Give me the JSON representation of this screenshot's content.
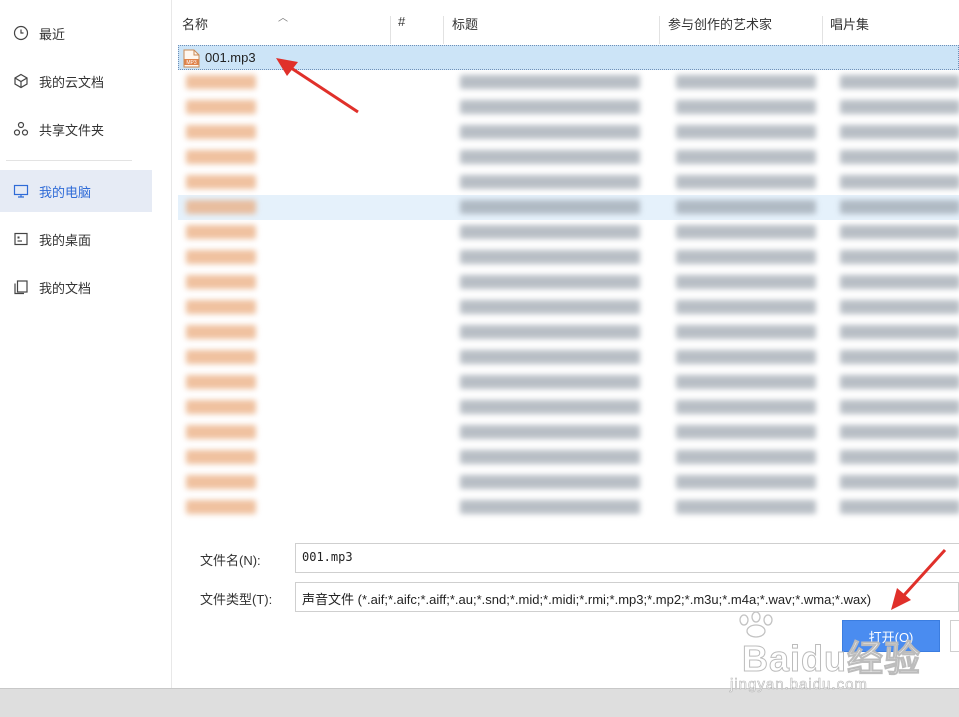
{
  "sidebar": {
    "items": [
      {
        "label": "最近",
        "icon": "clock-icon",
        "active": false
      },
      {
        "label": "我的云文档",
        "icon": "cloud-cube-icon",
        "active": false
      },
      {
        "label": "共享文件夹",
        "icon": "share-nodes-icon",
        "active": false
      },
      {
        "label": "我的电脑",
        "icon": "monitor-icon",
        "active": true
      },
      {
        "label": "我的桌面",
        "icon": "desktop-icon",
        "active": false
      },
      {
        "label": "我的文档",
        "icon": "documents-icon",
        "active": false
      }
    ]
  },
  "filelist": {
    "columns": {
      "name": "名称",
      "number": "#",
      "title": "标题",
      "artist": "参与创作的艺术家",
      "album": "唱片集"
    },
    "selected_file": "001.mp3",
    "file_icon": "mp3-file-icon"
  },
  "form": {
    "filename_label": "文件名(N):",
    "filename_value": "001.mp3",
    "filetype_label": "文件类型(T):",
    "filetype_value": "声音文件 (*.aif;*.aifc;*.aiff;*.au;*.snd;*.mid;*.midi;*.rmi;*.mp3;*.mp2;*.m3u;*.m4a;*.wav;*.wma;*.wax)",
    "open_button": "打开(O)"
  },
  "watermark": {
    "brand": "Baidu经验",
    "url": "jingyan.baidu.com"
  },
  "colors": {
    "accent": "#4a8cf0",
    "active_bg": "#e6ebf5",
    "selected_row": "#cce4f7",
    "annotation_arrow": "#e0302a"
  }
}
